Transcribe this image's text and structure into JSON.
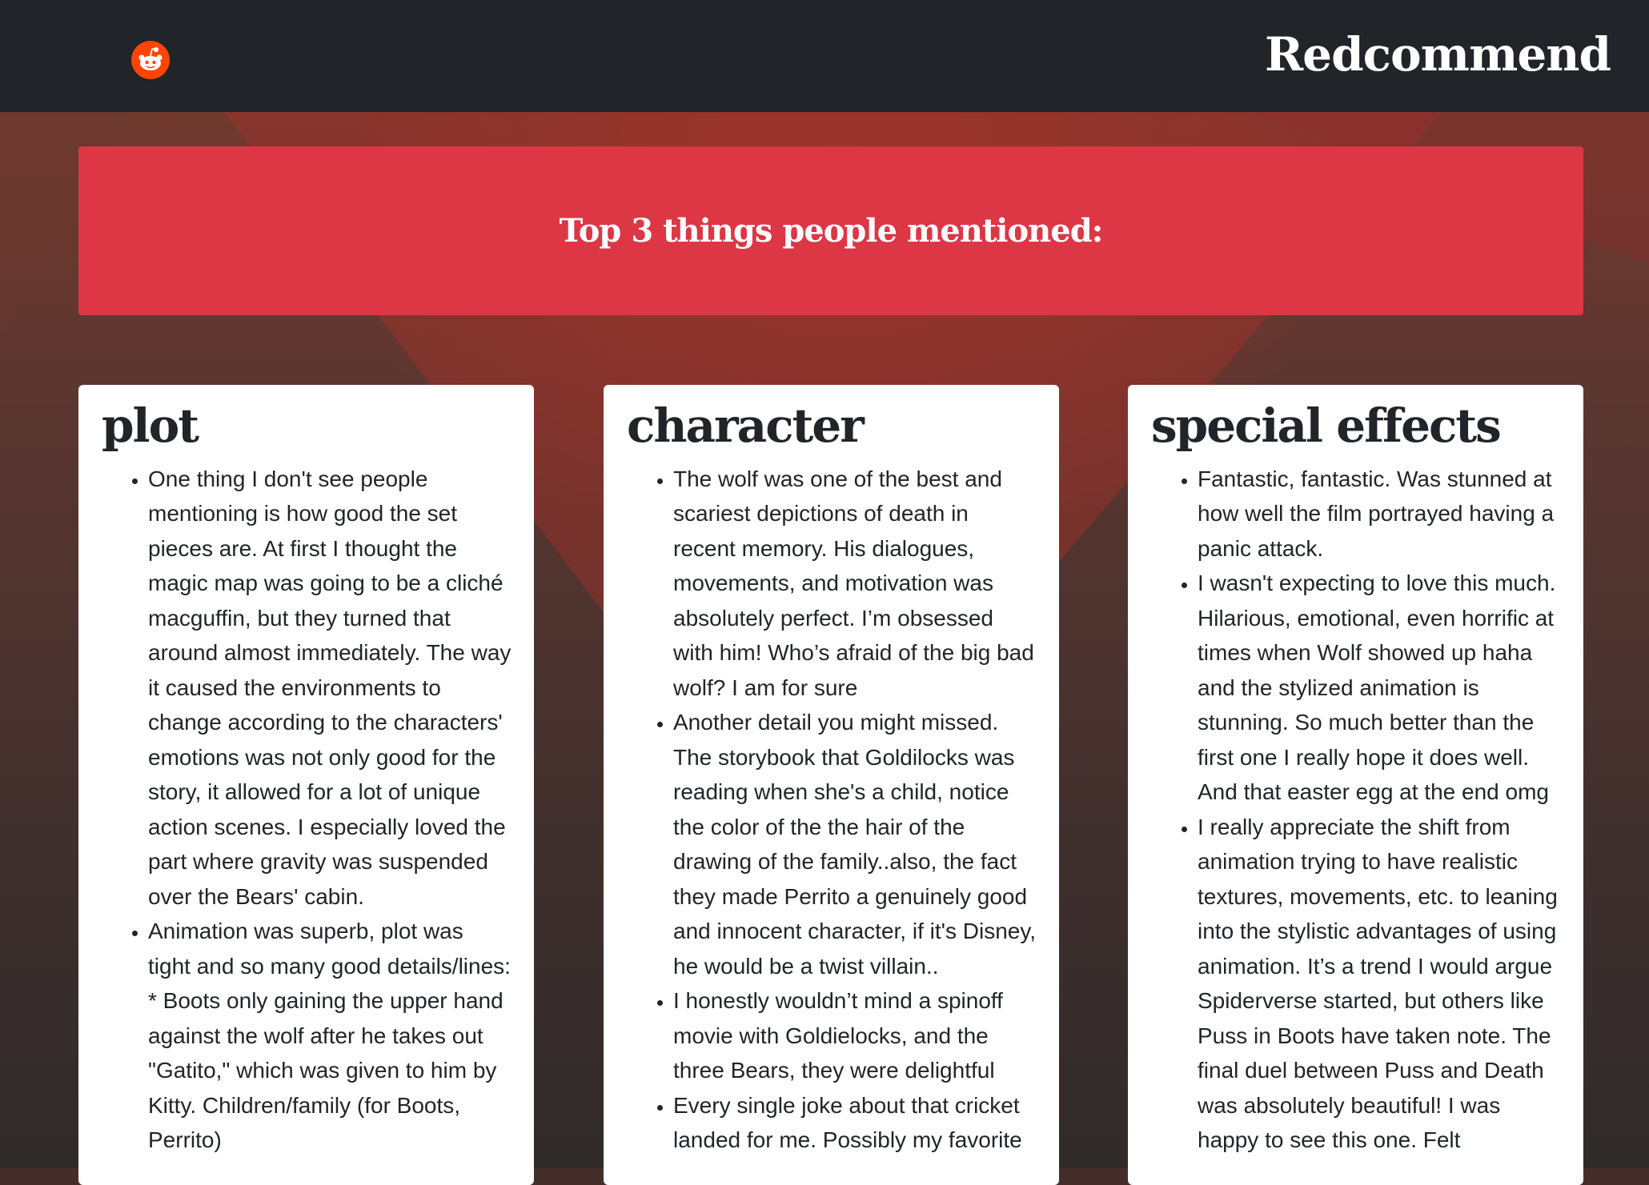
{
  "app": {
    "brand": "Redcommend",
    "logo_icon": "reddit-logo-icon"
  },
  "banner": {
    "title": "Top 3 things people mentioned:"
  },
  "colors": {
    "topbar": "#212429",
    "banner": "#dd3645",
    "logo": "#ff4500",
    "card": "#ffffff",
    "text": "#212529"
  },
  "cards": [
    {
      "title": "plot",
      "comments": [
        "One thing I don't see people mentioning is how good the set pieces are. At first I thought the magic map was going to be a cliché macguffin, but they turned that around almost immediately. The way it caused the environments to change according to the characters' emotions was not only good for the story, it allowed for a lot of unique action scenes. I especially loved the part where gravity was suspended over the Bears' cabin.",
        "Animation was superb, plot was tight and so many good details/lines: * Boots only gaining the upper hand against the wolf after he takes out \"Gatito,\" which was given to him by Kitty. Children/family (for Boots, Perrito)"
      ]
    },
    {
      "title": "character",
      "comments": [
        "The wolf was one of the best and scariest depictions of death in recent memory. His dialogues, movements, and motivation was absolutely perfect. I’m obsessed with him! Who’s afraid of the big bad wolf? I am for sure",
        "Another detail you might missed. The storybook that Goldilocks was reading when she's a child, notice the color of the the hair of the drawing of the family..also, the fact they made Perrito a genuinely good and innocent character, if it's Disney, he would be a twist villain..",
        "I honestly wouldn’t mind a spinoff movie with Goldielocks, and the three Bears, they were delightful",
        "Every single joke about that cricket landed for me. Possibly my favorite"
      ]
    },
    {
      "title": "special effects",
      "comments": [
        "Fantastic, fantastic. Was stunned at how well the film portrayed having a panic attack.",
        "I wasn't expecting to love this much. Hilarious, emotional, even horrific at times when Wolf showed up haha and the stylized animation is stunning. So much better than the first one I really hope it does well. And that easter egg at the end omg",
        "I really appreciate the shift from animation trying to have realistic textures, movements, etc. to leaning into the stylistic advantages of using animation. It’s a trend I would argue Spiderverse started, but others like Puss in Boots have taken note. The final duel between Puss and Death was absolutely beautiful! I was happy to see this one. Felt"
      ]
    }
  ]
}
